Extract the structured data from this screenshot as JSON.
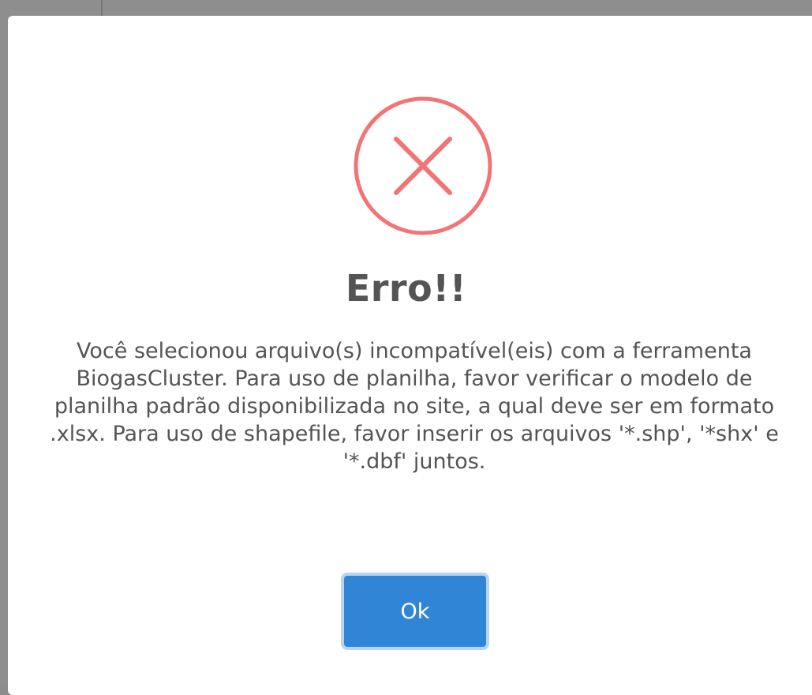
{
  "dialog": {
    "icon": "error-x-circle-icon",
    "icon_color": "#f27474",
    "title": "Erro!!",
    "message": "Você selecionou arquivo(s) incompatível(eis) com a ferramenta BiogasCluster. Para uso de planilha, favor verificar o modelo de planilha padrão disponibilizada no site, a qual deve ser em formato .xlsx. Para uso de shapefile, favor inserir os arquivos '*.shp', '*shx' e '*.dbf' juntos.",
    "confirm_label": "Ok",
    "confirm_color": "#3085d6",
    "text_color": "#545454"
  }
}
